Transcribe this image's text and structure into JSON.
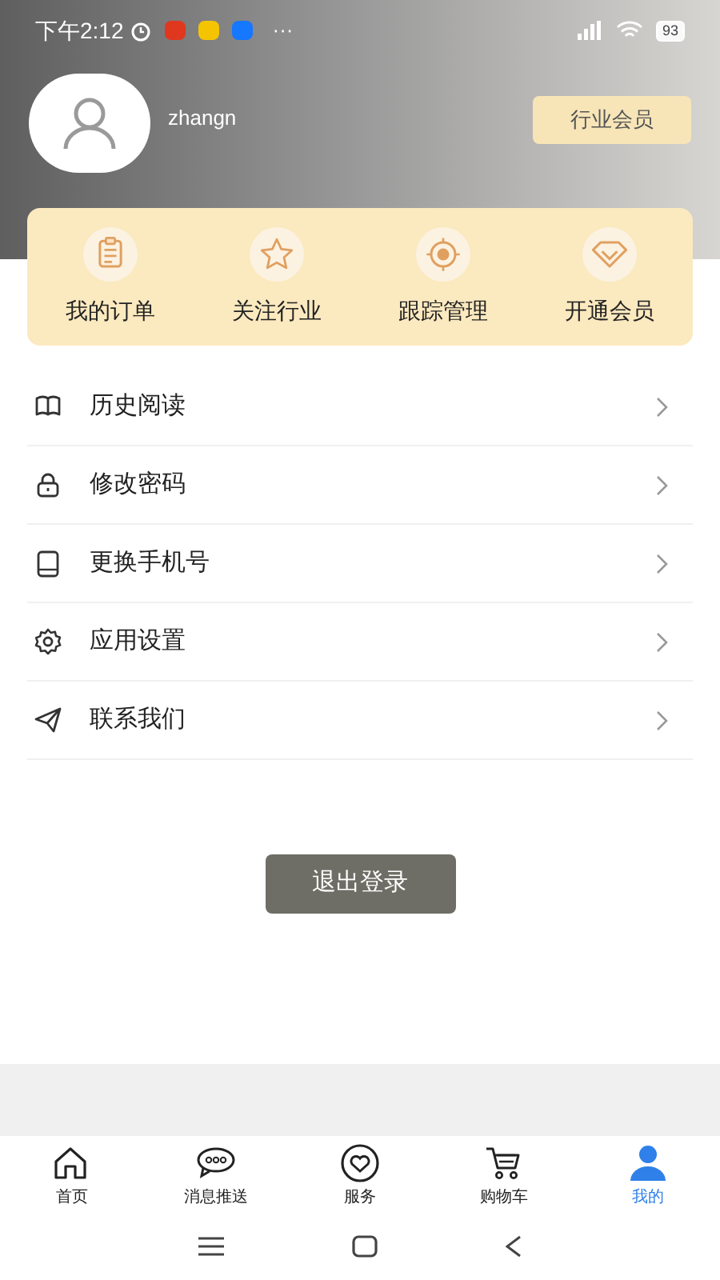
{
  "status_bar": {
    "time": "下午2:12",
    "more": "···",
    "battery": "93"
  },
  "profile": {
    "username": "zhangn",
    "member_button": "行业会员"
  },
  "quick_actions": [
    {
      "label": "我的订单"
    },
    {
      "label": "关注行业"
    },
    {
      "label": "跟踪管理"
    },
    {
      "label": "开通会员"
    }
  ],
  "menu": [
    {
      "label": "历史阅读"
    },
    {
      "label": "修改密码"
    },
    {
      "label": "更换手机号"
    },
    {
      "label": "应用设置"
    },
    {
      "label": "联系我们"
    }
  ],
  "logout_button": "退出登录",
  "tab_bar": [
    {
      "label": "首页",
      "selected": false
    },
    {
      "label": "消息推送",
      "selected": false
    },
    {
      "label": "服务",
      "selected": false
    },
    {
      "label": "购物车",
      "selected": false
    },
    {
      "label": "我的",
      "selected": true
    }
  ]
}
